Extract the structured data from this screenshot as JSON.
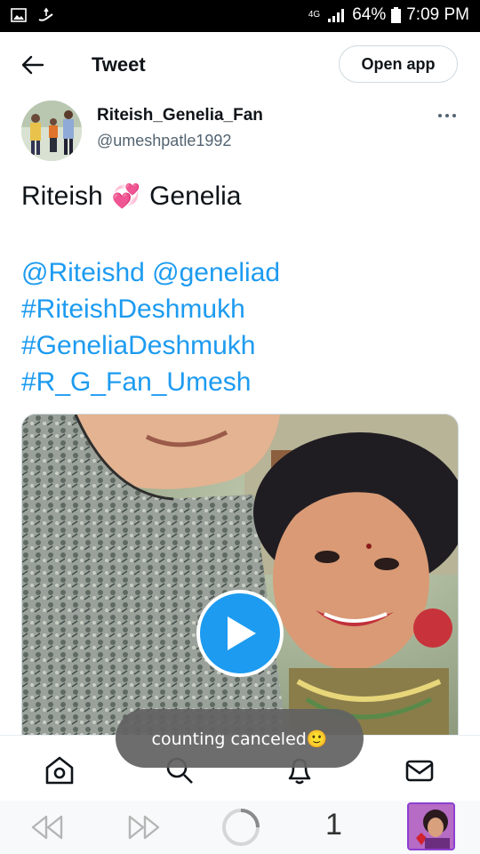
{
  "status_bar": {
    "network": "4G",
    "battery": "64%",
    "time": "7:09 PM"
  },
  "header": {
    "title": "Tweet",
    "open_app_label": "Open app"
  },
  "tweet": {
    "display_name": "Riteish_Genelia_Fan",
    "handle": "@umeshpatle1992",
    "text_name_1": "Riteish",
    "text_emoji": "💞",
    "text_name_2": "Genelia",
    "links": [
      "@Riteishd @geneliad",
      "#RiteishDeshmukh",
      "#GeneliaDeshmukh",
      "#R_G_Fan_Umesh"
    ]
  },
  "toast": {
    "message": "counting canceled🙂"
  },
  "browser": {
    "tab_count": "1"
  },
  "colors": {
    "accent": "#1d9bf0",
    "text": "#0f1419",
    "secondary": "#536471",
    "toast_bg": "#626262"
  },
  "icons": {
    "back": "arrow-left-icon",
    "more": "more-dots-icon",
    "play": "play-icon",
    "home": "home-icon",
    "search": "search-icon",
    "notifications": "bell-icon",
    "messages": "mail-icon",
    "rewind": "rewind-icon",
    "forward": "fast-forward-icon",
    "loading": "loading-spinner-icon"
  }
}
